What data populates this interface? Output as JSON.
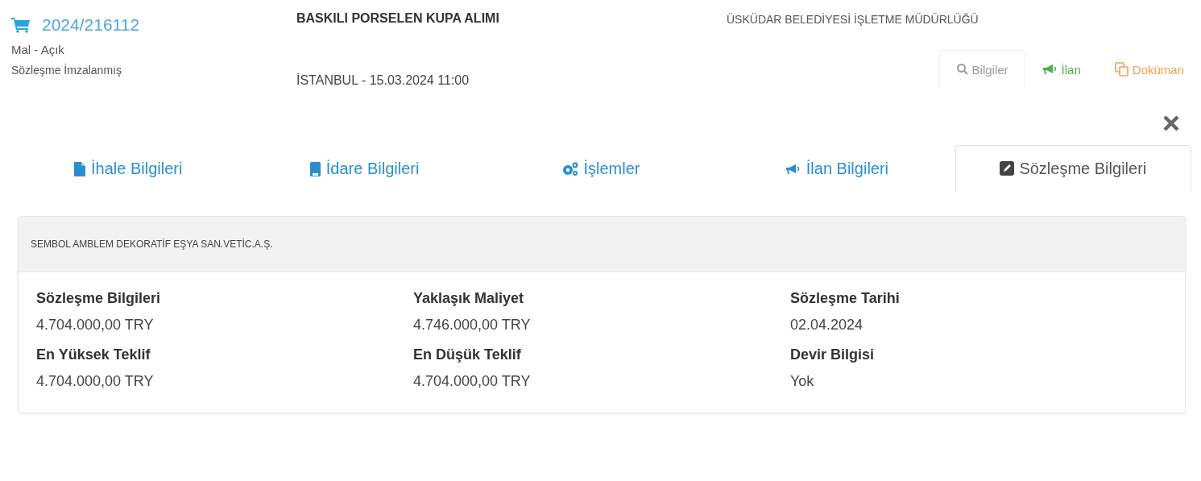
{
  "header": {
    "number": "2024/216112",
    "type": "Mal - Açık",
    "status": "Sözleşme İmzalanmış",
    "title": "BASKILI PORSELEN KUPA ALIMI",
    "place_date": "İSTANBUL - 15.03.2024 11:00",
    "authority": "ÜSKÜDAR BELEDİYESİ İŞLETME MÜDÜRLÜĞÜ",
    "actions": [
      {
        "label": "Bilgiler",
        "kind": "search",
        "selected": true
      },
      {
        "label": "İlan",
        "kind": "megaphone",
        "selected": false
      },
      {
        "label": "Doküman",
        "kind": "copy",
        "selected": false
      }
    ]
  },
  "tabs": [
    {
      "label": "İhale Bilgileri",
      "kind": "file",
      "selected": false
    },
    {
      "label": "İdare Bilgileri",
      "kind": "book",
      "selected": false
    },
    {
      "label": "İşlemler",
      "kind": "gears",
      "selected": false
    },
    {
      "label": "İlan Bilgileri",
      "kind": "megaphone",
      "selected": false
    },
    {
      "label": "Sözleşme Bilgileri",
      "kind": "edit",
      "selected": true
    }
  ],
  "contract": {
    "company": "SEMBOL AMBLEM DEKORATİF EŞYA SAN.VETİC.A.Ş.",
    "fields": [
      {
        "label": "Sözleşme Bilgileri",
        "value": "4.704.000,00 TRY"
      },
      {
        "label": "Yaklaşık Maliyet",
        "value": "4.746.000,00 TRY"
      },
      {
        "label": "Sözleşme Tarihi",
        "value": "02.04.2024"
      },
      {
        "label": "En Yüksek Teklif",
        "value": "4.704.000,00 TRY"
      },
      {
        "label": "En Düşük Teklif",
        "value": "4.704.000,00 TRY"
      },
      {
        "label": "Devir Bilgisi",
        "value": "Yok"
      }
    ]
  }
}
